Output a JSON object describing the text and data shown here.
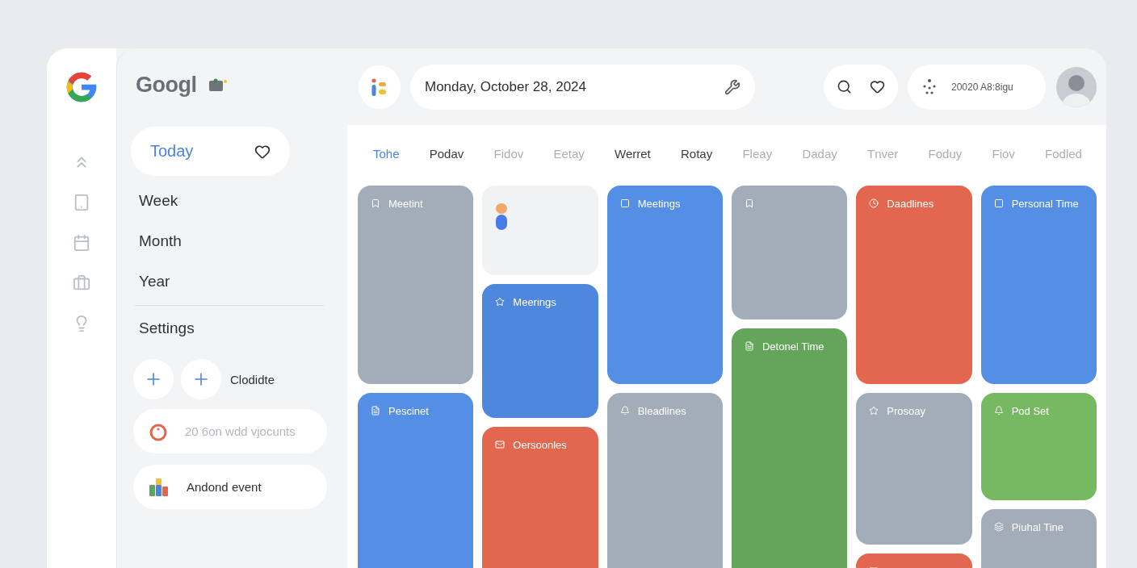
{
  "sidebar": {
    "brand": "Googl",
    "nav": [
      {
        "label": "Today",
        "selected": true
      },
      {
        "label": "Week",
        "selected": false
      },
      {
        "label": "Month",
        "selected": false
      },
      {
        "label": "Year",
        "selected": false
      }
    ],
    "settings": "Settings",
    "quick_label": "Clodidte",
    "timer_field": {
      "placeholder": "20 6on wdd vjocunts"
    },
    "add_event": "Andond event"
  },
  "topbar": {
    "date": "Monday, October 28, 2024",
    "status": "20020 A8:8igu"
  },
  "days": [
    {
      "label": "Tohe",
      "selected": true,
      "dimmed": false
    },
    {
      "label": "Podav",
      "selected": false,
      "dimmed": false
    },
    {
      "label": "Fidov",
      "selected": false,
      "dimmed": true
    },
    {
      "label": "Eetay",
      "selected": false,
      "dimmed": true
    },
    {
      "label": "Werret",
      "selected": false,
      "dimmed": false
    },
    {
      "label": "Rotay",
      "selected": false,
      "dimmed": false
    },
    {
      "label": "Fleay",
      "selected": false,
      "dimmed": true
    },
    {
      "label": "Daday",
      "selected": false,
      "dimmed": true
    },
    {
      "label": "Tnver",
      "selected": false,
      "dimmed": true
    },
    {
      "label": "Foduy",
      "selected": false,
      "dimmed": true
    },
    {
      "label": "Fiov",
      "selected": false,
      "dimmed": true
    },
    {
      "label": "Fodled",
      "selected": false,
      "dimmed": true
    }
  ],
  "columns": [
    {
      "events": [
        {
          "kind": "event",
          "title": "Meetint",
          "color": "#a3adb9"
        },
        {
          "kind": "event",
          "title": "Pescinet",
          "color": "#548ee5"
        }
      ]
    },
    {
      "events": [
        {
          "kind": "note",
          "color": "#f1f2f3"
        },
        {
          "kind": "event",
          "title": "Meerings",
          "color": "#4e87dc"
        },
        {
          "kind": "event",
          "title": "Oersoonles",
          "color": "#e3664f"
        }
      ]
    },
    {
      "events": [
        {
          "kind": "event",
          "title": "Meetings",
          "color": "#548ee5"
        },
        {
          "kind": "event",
          "title": "Bleadlines",
          "color": "#a3adb9"
        }
      ]
    },
    {
      "events": [
        {
          "kind": "event",
          "color": "#a3adb9"
        },
        {
          "kind": "event",
          "title": "Detonel Time",
          "color": "#64a45b"
        }
      ]
    },
    {
      "events": [
        {
          "kind": "event",
          "title": "Daadlines",
          "color": "#e3664f"
        },
        {
          "kind": "event",
          "title": "Prosoay",
          "color": "#a3adb9"
        },
        {
          "kind": "event",
          "color": "#e3664f"
        }
      ]
    },
    {
      "events": [
        {
          "kind": "event",
          "title": "Personal Time",
          "color": "#548ee5"
        },
        {
          "kind": "event",
          "title": "Pod Set",
          "color": "#77b961"
        },
        {
          "kind": "event",
          "title": "Piuhal Tine",
          "color": "#a3adb9"
        }
      ]
    }
  ]
}
